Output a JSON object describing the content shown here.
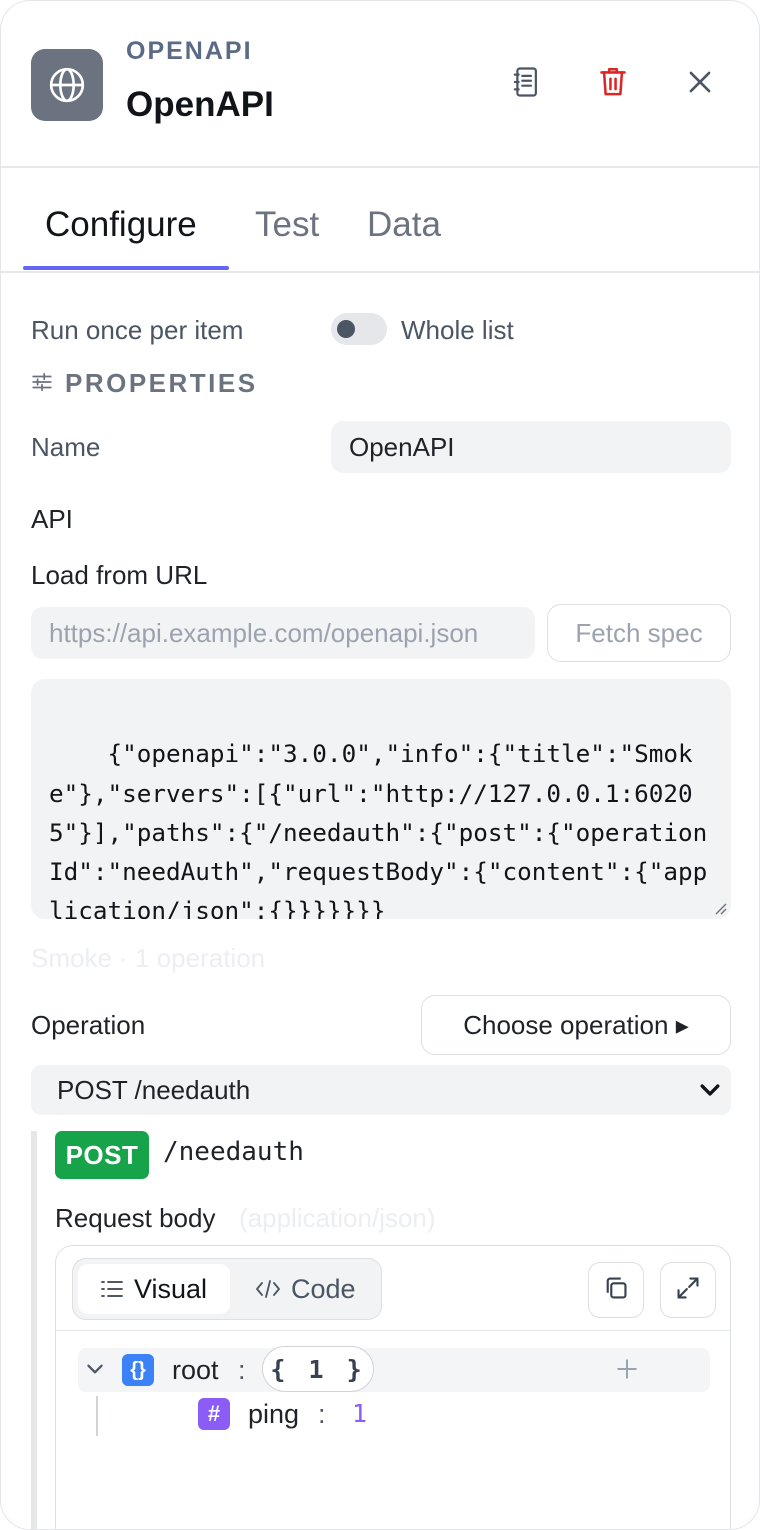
{
  "header": {
    "kicker": "OPENAPI",
    "title": "OpenAPI",
    "logo_icon": "globe-icon",
    "actions": [
      "notes-icon",
      "trash-icon",
      "close-icon"
    ]
  },
  "tabs": [
    {
      "label": "Configure",
      "active": true
    },
    {
      "label": "Test",
      "active": false
    },
    {
      "label": "Data",
      "active": false
    }
  ],
  "run_mode": {
    "label": "Run once per item",
    "toggle_label": "Whole list",
    "toggle_on": false
  },
  "properties": {
    "heading": "PROPERTIES",
    "name_label": "Name",
    "name_value": "OpenAPI",
    "api_label": "API",
    "load_label": "Load from URL",
    "url_placeholder": "https://api.example.com/openapi.json",
    "fetch_label": "Fetch spec",
    "spec_text": "{\"openapi\":\"3.0.0\",\"info\":{\"title\":\"Smoke\"},\"servers\":[{\"url\":\"http://127.0.0.1:60205\"}],\"paths\":{\"/needauth\":{\"post\":{\"operationId\":\"needAuth\",\"requestBody\":{\"content\":{\"application/json\":{}}}}}}}",
    "spec_summary": "Smoke · 1 operation"
  },
  "operation": {
    "label": "Operation",
    "choose_label": "Choose operation ▸",
    "selected": "POST /needauth",
    "method": "POST",
    "path": "/needauth",
    "method_color": "#16a34a",
    "body_label": "Request body",
    "body_type": "(application/json)"
  },
  "editor": {
    "visual_label": "Visual",
    "code_label": "Code",
    "root_key": "root",
    "root_count": "{ 1 }",
    "field_key": "ping",
    "field_value": "1"
  },
  "colors": {
    "accent": "#6366f1",
    "danger": "#dc2626",
    "number": "#8b5cf6",
    "object": "#3b82f6"
  }
}
